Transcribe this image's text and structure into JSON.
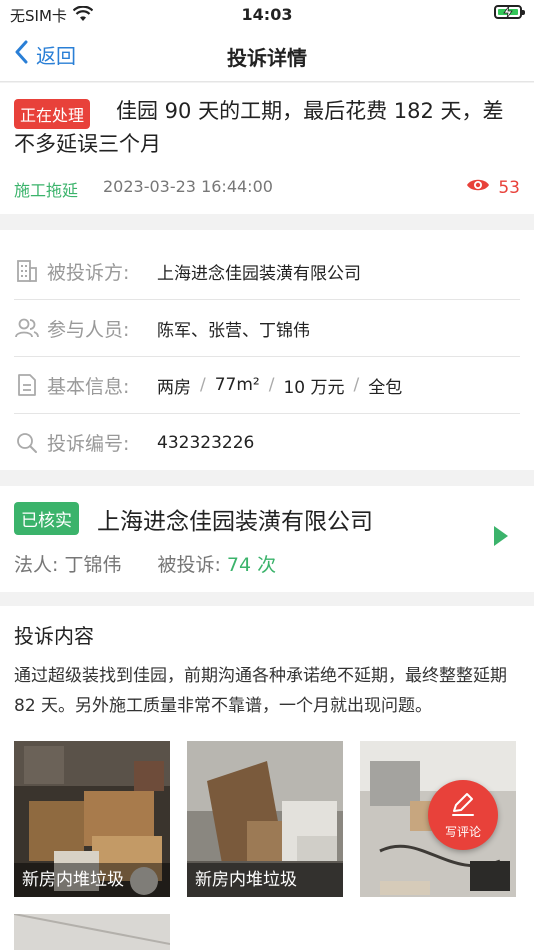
{
  "status_bar": {
    "carrier": "无SIM卡",
    "time": "14:03"
  },
  "nav": {
    "back_label": "返回",
    "title": "投诉详情"
  },
  "complaint": {
    "status": "正在处理",
    "title_line1": "佳园 90 天的工期，最后花费 182 天，差",
    "title_line2": "不多延误三个月",
    "category": "施工拖延",
    "datetime": "2023-03-23 16:44:00",
    "views": "53"
  },
  "info": {
    "respondent_label": "被投诉方:",
    "respondent_value": "上海进念佳园装潢有限公司",
    "participants_label": "参与人员:",
    "participants_value": "陈军、张营、丁锦伟",
    "basic_label": "基本信息:",
    "basic_rooms": "两房",
    "basic_area": "77m²",
    "basic_budget": "10 万元",
    "basic_type": "全包",
    "number_label": "投诉编号:",
    "number_value": "432323226"
  },
  "company": {
    "verified": "已核实",
    "name": "上海进念佳园装潢有限公司",
    "legal_label": "法人:",
    "legal_value": "丁锦伟",
    "complaints_label": "被投诉:",
    "complaints_value": "74 次"
  },
  "content": {
    "heading": "投诉内容",
    "body": "通过超级装找到佳园，前期沟通各种承诺绝不延期，最终整整延期 82 天。另外施工质量非常不靠谱，一个月就出现问题。",
    "photo_captions": [
      "新房内堆垃圾",
      "新房内堆垃圾"
    ]
  },
  "fab": {
    "label": "写评论"
  },
  "colors": {
    "accent_red": "#e8413a",
    "accent_green": "#3bb36b",
    "link_blue": "#2a7fd6"
  }
}
